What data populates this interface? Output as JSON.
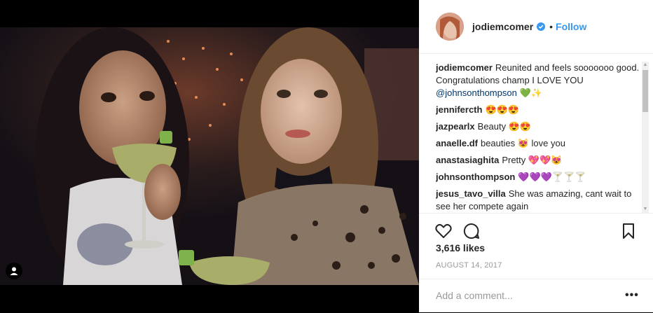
{
  "post": {
    "username": "jodiemcomer",
    "follow_label": "Follow",
    "separator": "•",
    "likes": "3,616 likes",
    "date": "AUGUST 14, 2017",
    "add_comment_placeholder": "Add a comment...",
    "more_label": "•••"
  },
  "caption": {
    "user": "jodiemcomer",
    "text": "Reunited and feels sooooooo good. Congratulations champ I LOVE YOU",
    "mention": "@johnsonthompson",
    "emoji": "💚✨"
  },
  "comments": [
    {
      "user": "jennifercth",
      "text": "😍😍😍"
    },
    {
      "user": "jazpearlx",
      "text": "Beauty 😍😍"
    },
    {
      "user": "anaelle.df",
      "text": "beauties 😻 love you"
    },
    {
      "user": "anastasiaghita",
      "text": "Pretty 💖💖😻"
    },
    {
      "user": "johnsonthompson",
      "text": "💜💜💜🍸🍸🍸"
    },
    {
      "user": "jesus_tavo_villa",
      "text": "She was amazing, cant wait to see her compete again"
    }
  ],
  "colors": {
    "link": "#3897f0",
    "verified": "#3897f0",
    "text": "#262626",
    "muted": "#999999"
  }
}
